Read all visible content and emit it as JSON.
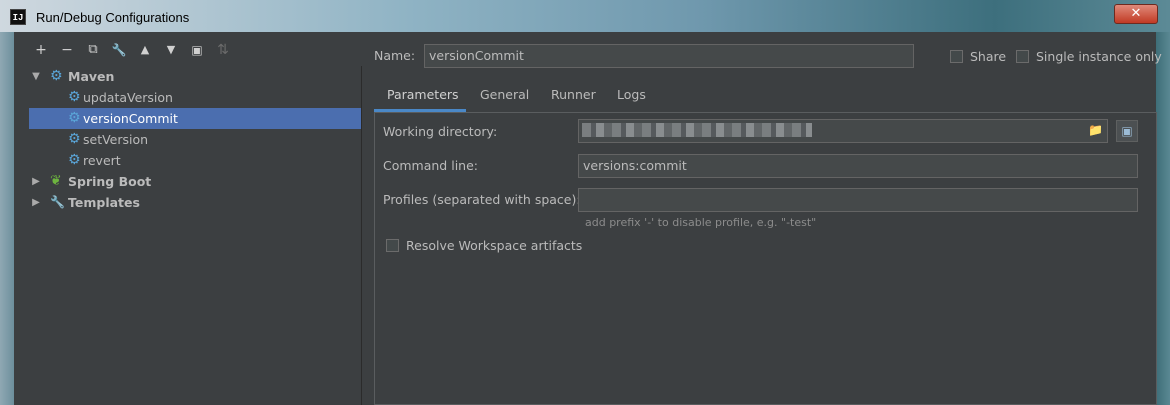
{
  "window": {
    "title": "Run/Debug Configurations",
    "logo_text": "IJ",
    "close_symbol": "✕"
  },
  "toolbar": [
    {
      "name": "add-icon",
      "glyph": "+"
    },
    {
      "name": "remove-icon",
      "glyph": "−"
    },
    {
      "name": "copy-icon",
      "glyph": "⧉"
    },
    {
      "name": "wrench-icon",
      "glyph": "🔧"
    },
    {
      "name": "move-up-icon",
      "glyph": "▲"
    },
    {
      "name": "move-down-icon",
      "glyph": "▼"
    },
    {
      "name": "new-folder-icon",
      "glyph": "▣"
    },
    {
      "name": "sort-icon",
      "glyph": "⇅"
    }
  ],
  "tree": {
    "maven": "Maven",
    "maven_children": [
      "updataVersion",
      "versionCommit",
      "setVersion",
      "revert"
    ],
    "spring_boot": "Spring Boot",
    "templates": "Templates"
  },
  "form": {
    "name_label": "Name:",
    "name_value": "versionCommit",
    "share_label": "Share",
    "single_instance_label": "Single instance only"
  },
  "tabs": [
    "Parameters",
    "General",
    "Runner",
    "Logs"
  ],
  "parameters": {
    "working_directory_label": "Working directory:",
    "command_line_label": "Command line:",
    "command_line_value": "versions:commit",
    "profiles_label": "Profiles (separated with space):",
    "profiles_value": "",
    "profiles_hint": "add prefix '-' to disable profile, e.g. \"-test\"",
    "resolve_workspace_label": "Resolve Workspace artifacts"
  },
  "colors": {
    "selection": "#4b6eaf",
    "accent_tab": "#4a88c7",
    "maven_gear": "#5aa5d8",
    "spring_leaf": "#6db33f"
  }
}
